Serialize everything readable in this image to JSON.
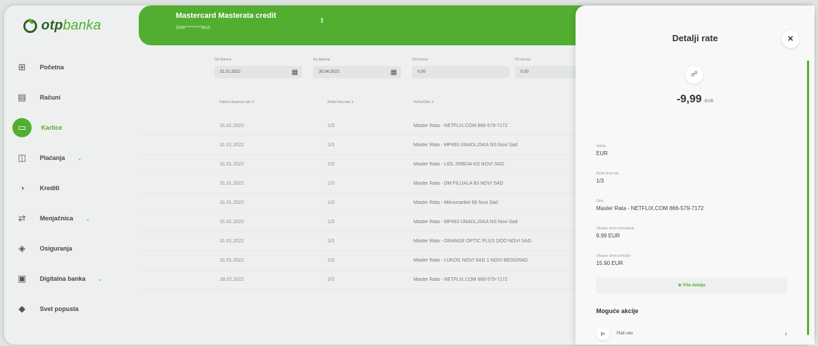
{
  "logo": {
    "brand": "otp",
    "brand_light": "banka"
  },
  "sidebar": {
    "items": [
      {
        "label": "Početna",
        "icon": "home-grid-icon",
        "glyph": "⊞",
        "caret": false
      },
      {
        "label": "Računi",
        "icon": "accounts-icon",
        "glyph": "▤",
        "caret": false
      },
      {
        "label": "Kartice",
        "icon": "card-icon",
        "glyph": "▭",
        "caret": false,
        "active": true
      },
      {
        "label": "Plaćanja",
        "icon": "payment-icon",
        "glyph": "◫",
        "caret": true
      },
      {
        "label": "Krediti",
        "icon": "loan-icon",
        "glyph": "◔",
        "caret": false
      },
      {
        "label": "Menjačnica",
        "icon": "exchange-icon",
        "glyph": "⇄",
        "caret": true
      },
      {
        "label": "Osiguranja",
        "icon": "insurance-icon",
        "glyph": "◈",
        "caret": false
      },
      {
        "label": "Digitalna banka",
        "icon": "monitor-icon",
        "glyph": "▣",
        "caret": true
      },
      {
        "label": "Svet popusta",
        "icon": "tag-icon",
        "glyph": "◆",
        "caret": false
      }
    ]
  },
  "header": {
    "card_name": "Mastercard Masterata credit",
    "card_number": "5306**********3615",
    "switch_glyph": "⇕"
  },
  "filters": {
    "from_date": {
      "label": "Od datuma",
      "value": "31.01.2022"
    },
    "to_date": {
      "label": "Do datuma",
      "value": "30.04.2022"
    },
    "from_amount": {
      "label": "Od iznosa",
      "value": "0,00"
    },
    "to_amount": {
      "label": "Do iznosa",
      "value": "0,00"
    }
  },
  "table": {
    "headers": [
      "Datum dospeća rate ⇕",
      "Redni broj rate ⇕",
      "Svrha/Opis ⇕"
    ],
    "rows": [
      {
        "date": "31.01.2022",
        "installment": "1/3",
        "desc": "Master Rata - NETFLIX.COM 866-579-7172"
      },
      {
        "date": "31.01.2022",
        "installment": "1/3",
        "desc": "Master Rata - MP493 UNADLJSKA NS Novi Sad"
      },
      {
        "date": "31.01.2022",
        "installment": "1/3",
        "desc": "Master Rata - LIDL SRBIJA KD NOVI SAD"
      },
      {
        "date": "31.01.2022",
        "installment": "1/3",
        "desc": "Master Rata - DM FILIJALA 83 NOVI SAD"
      },
      {
        "date": "31.01.2022",
        "installment": "1/3",
        "desc": "Master Rata - Mikromarket 68 Novi Sad"
      },
      {
        "date": "31.01.2022",
        "installment": "1/3",
        "desc": "Master Rata - MP493 UNADLJSKA NS Novi Sad"
      },
      {
        "date": "31.01.2022",
        "installment": "1/3",
        "desc": "Master Rata - ORANGE OPTIC PLUS DOO NOVI SAD"
      },
      {
        "date": "31.01.2022",
        "installment": "1/3",
        "desc": "Master Rata - LUKOIL NOVI SAD 1 NOVI BEOGRAD"
      },
      {
        "date": "28.02.2022",
        "installment": "2/3",
        "desc": "Master Rata - NETFLIX.COM 866-579-7172"
      }
    ]
  },
  "panel": {
    "title": "Detalji rate",
    "close_glyph": "✕",
    "amount_icon_glyph": "☍",
    "amount": "-9,99",
    "currency": "EUR",
    "fields": [
      {
        "label": "Valuta",
        "value": "EUR"
      },
      {
        "label": "Redni broj rate",
        "value": "1/3"
      },
      {
        "label": "Opis",
        "value": "Master Rata - NETFLIX.COM 866-579-7172"
      },
      {
        "label": "Ukupan iznos transakcije",
        "value": "9.99 EUR"
      },
      {
        "label": "Ukupan iznos provizije",
        "value": "15.90 EUR"
      }
    ],
    "more_details": "⊕ Više detalja",
    "actions_title": "Moguće akcije",
    "action": {
      "label": "Plati ratu",
      "icon_glyph": "⊳",
      "chevron": "›"
    }
  },
  "colors": {
    "accent": "#52ae30",
    "brand_dark": "#2f5f24"
  }
}
